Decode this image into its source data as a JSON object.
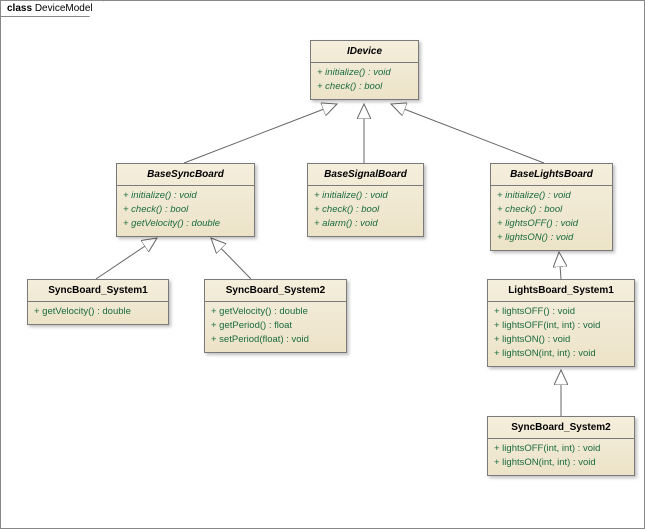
{
  "frame": {
    "kind": "class",
    "name": "DeviceModel"
  },
  "classes": {
    "idevice": {
      "name": "IDevice",
      "ops": [
        "+   initialize() : void",
        "+   check() : bool"
      ]
    },
    "basesync": {
      "name": "BaseSyncBoard",
      "ops": [
        "+   initialize() : void",
        "+   check() : bool",
        "+   getVelocity() : double"
      ]
    },
    "basesignal": {
      "name": "BaseSignalBoard",
      "ops": [
        "+   initialize() : void",
        "+   check() : bool",
        "+   alarm() : void"
      ]
    },
    "baselights": {
      "name": "BaseLightsBoard",
      "ops": [
        "+   initialize() : void",
        "+   check() : bool",
        "+   lightsOFF() : void",
        "+   lightsON() : void"
      ]
    },
    "sync1": {
      "name": "SyncBoard_System1",
      "ops": [
        "+   getVelocity() : double"
      ]
    },
    "sync2": {
      "name": "SyncBoard_System2",
      "ops": [
        "+   getVelocity() : double",
        "+   getPeriod() : float",
        "+   setPeriod(float) : void"
      ]
    },
    "lights1": {
      "name": "LightsBoard_System1",
      "ops": [
        "+   lightsOFF() : void",
        "+   lightsOFF(int, int) : void",
        "+   lightsON() : void",
        "+   lightsON(int, int) : void"
      ]
    },
    "sync2b": {
      "name": "SyncBoard_System2",
      "ops": [
        "+   lightsOFF(int, int) : void",
        "+   lightsON(int, int) : void"
      ]
    }
  }
}
